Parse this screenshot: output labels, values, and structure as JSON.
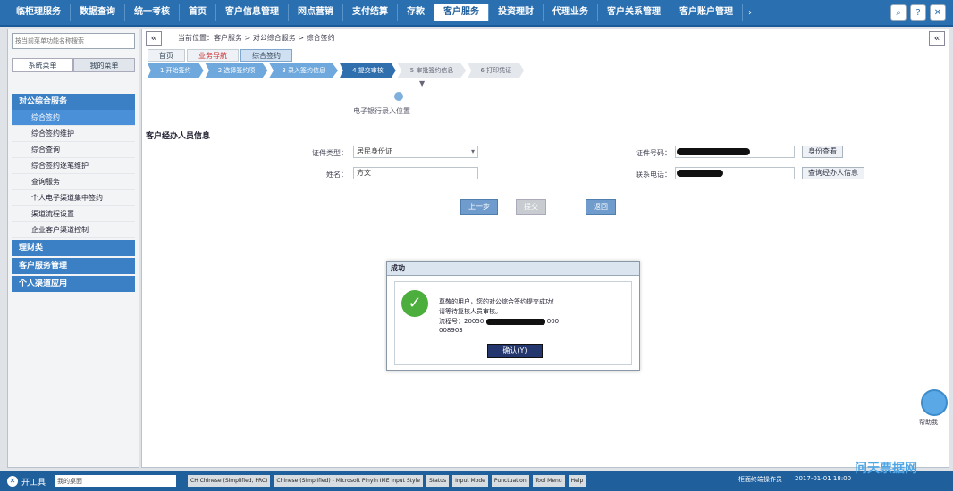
{
  "topnav": {
    "items": [
      "临柜理服务",
      "数据查询",
      "统一考核",
      "首页",
      "客户信息管理",
      "网点营销",
      "支付结算",
      "存款",
      "客户服务",
      "投资理财",
      "代理业务",
      "客户关系管理",
      "客户账户管理"
    ],
    "active_index": 8,
    "more": "›",
    "tools": [
      "⌕",
      "?",
      "✕"
    ]
  },
  "sidebar": {
    "search_placeholder": "按当前菜单功能名称搜索",
    "tabs": [
      "系统菜单",
      "我的菜单"
    ],
    "group_main": "对公综合服务",
    "items": [
      "综合签约",
      "综合签约维护",
      "综合查询",
      "综合签约逐笔维护",
      "查询服务",
      "个人电子渠道集中签约",
      "渠道流程设置",
      "企业客户渠道控制"
    ],
    "selected_index": 0,
    "groups": [
      "理财类",
      "客户服务管理",
      "个人渠道应用"
    ]
  },
  "main": {
    "collapse": "«",
    "breadcrumb": "当前位置：客户服务 > 对公综合服务 > 综合签约",
    "page_tabs": [
      "首页",
      "业务导航",
      "综合签约"
    ],
    "steps": [
      "1 开始签约",
      "2 选择签约项",
      "3 录入签约信息",
      "4 提交审核",
      "5 审批签约信息",
      "6 打印凭证"
    ],
    "current_step": 3,
    "step_marker": "▼",
    "sig_text": "电子银行录入位置",
    "section_title": "客户经办人员信息",
    "form": {
      "id_type_label": "证件类型：",
      "id_type_value": "居民身份证",
      "id_no_label": "证件号码：",
      "id_btn": "身份查看",
      "name_label": "姓名：",
      "name_value": "方文",
      "phone_label": "联系电话：",
      "phone_btn": "查询经办人信息"
    },
    "actions": [
      "上一步",
      "提交",
      "返回"
    ]
  },
  "modal": {
    "title": "成功",
    "line1": "尊敬的用户，您的对公综合签约提交成功！",
    "line2": "请等待复核人员审核。",
    "line3": "流程号：20050",
    "line3_tail": "000",
    "line4": "008903",
    "confirm": "确认(Y)"
  },
  "float": {
    "label": "帮助我"
  },
  "taskbar": {
    "start": "开工具",
    "input": "我的桌面",
    "items": [
      "CH Chinese (Simplified, PRC)",
      "Chinese (Simplified) - Microsoft Pinyin IME Input Style",
      "Status",
      "Input Mode",
      "Punctuation",
      "Tool Menu",
      "Help"
    ],
    "right": [
      "柜面终端操作员",
      "2017-01-01 18:00"
    ]
  },
  "watermark": "问天票据网"
}
